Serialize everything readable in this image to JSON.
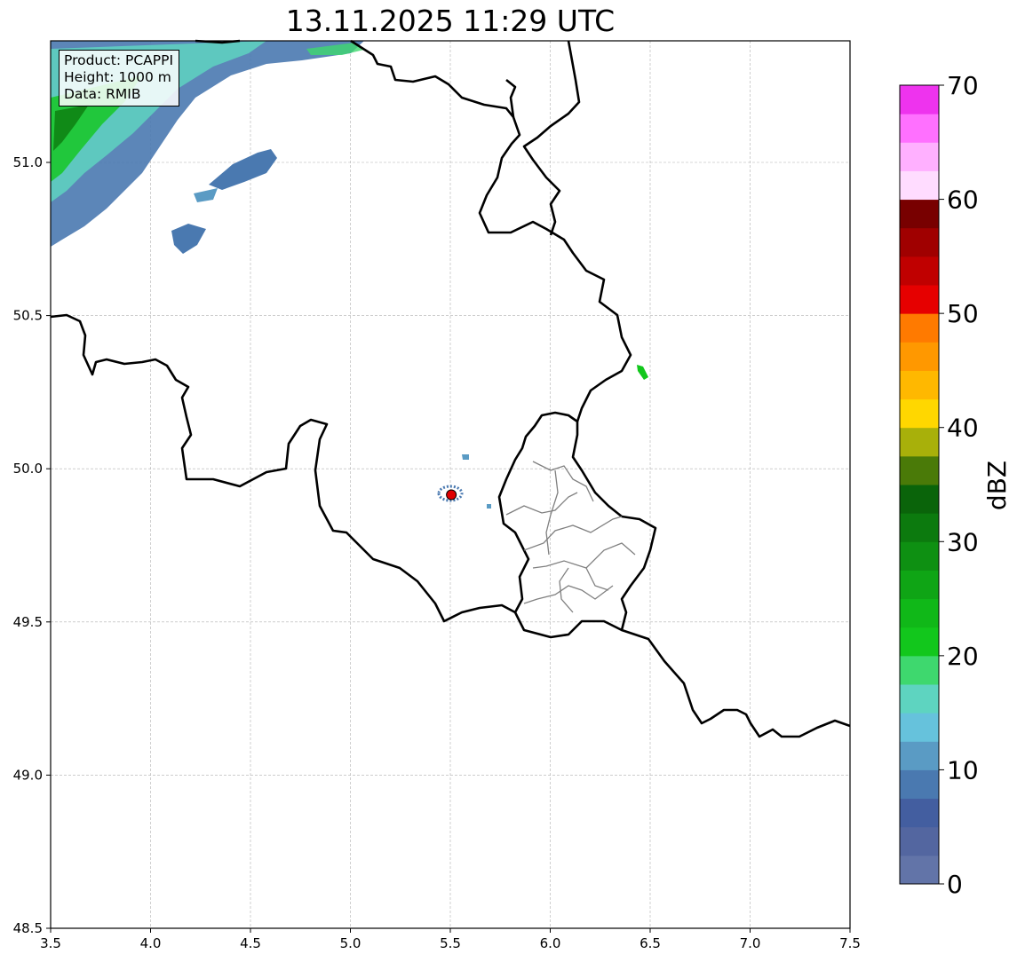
{
  "title": "13.11.2025 11:29 UTC",
  "info": {
    "product": "Product: PCAPPI",
    "height": "Height: 1000 m",
    "data": "Data: RMIB"
  },
  "map": {
    "lon_range": [
      3.5,
      7.5
    ],
    "lat_range": [
      48.5,
      51.4
    ],
    "x_ticks": [
      "3.5",
      "4.0",
      "4.5",
      "5.0",
      "5.5",
      "6.0",
      "6.5",
      "7.0",
      "7.5"
    ],
    "y_ticks": [
      "48.5",
      "49.0",
      "49.5",
      "50.0",
      "50.5",
      "51.0"
    ],
    "grid": true,
    "radar_site": {
      "lon": 5.505,
      "lat": 49.915,
      "color": "#e00000"
    }
  },
  "colorbar": {
    "label": "dBZ",
    "ticks": [
      "0",
      "10",
      "20",
      "30",
      "40",
      "50",
      "60",
      "70"
    ],
    "range": [
      0,
      70
    ],
    "step": 2.5,
    "colors": [
      "#6274a8",
      "#5366a0",
      "#435ea0",
      "#4a79b0",
      "#5a9bc4",
      "#66c2dc",
      "#5ed4c0",
      "#3ed86e",
      "#12c71c",
      "#10b818",
      "#0fa515",
      "#0e9012",
      "#0c7a0e",
      "#0a640a",
      "#4a7a08",
      "#a8b00a",
      "#ffd700",
      "#ffb800",
      "#ff9800",
      "#ff7a00",
      "#e60000",
      "#c00000",
      "#a00000",
      "#780000",
      "#ffdcff",
      "#ffb0ff",
      "#ff70ff",
      "#ee33ee"
    ]
  }
}
